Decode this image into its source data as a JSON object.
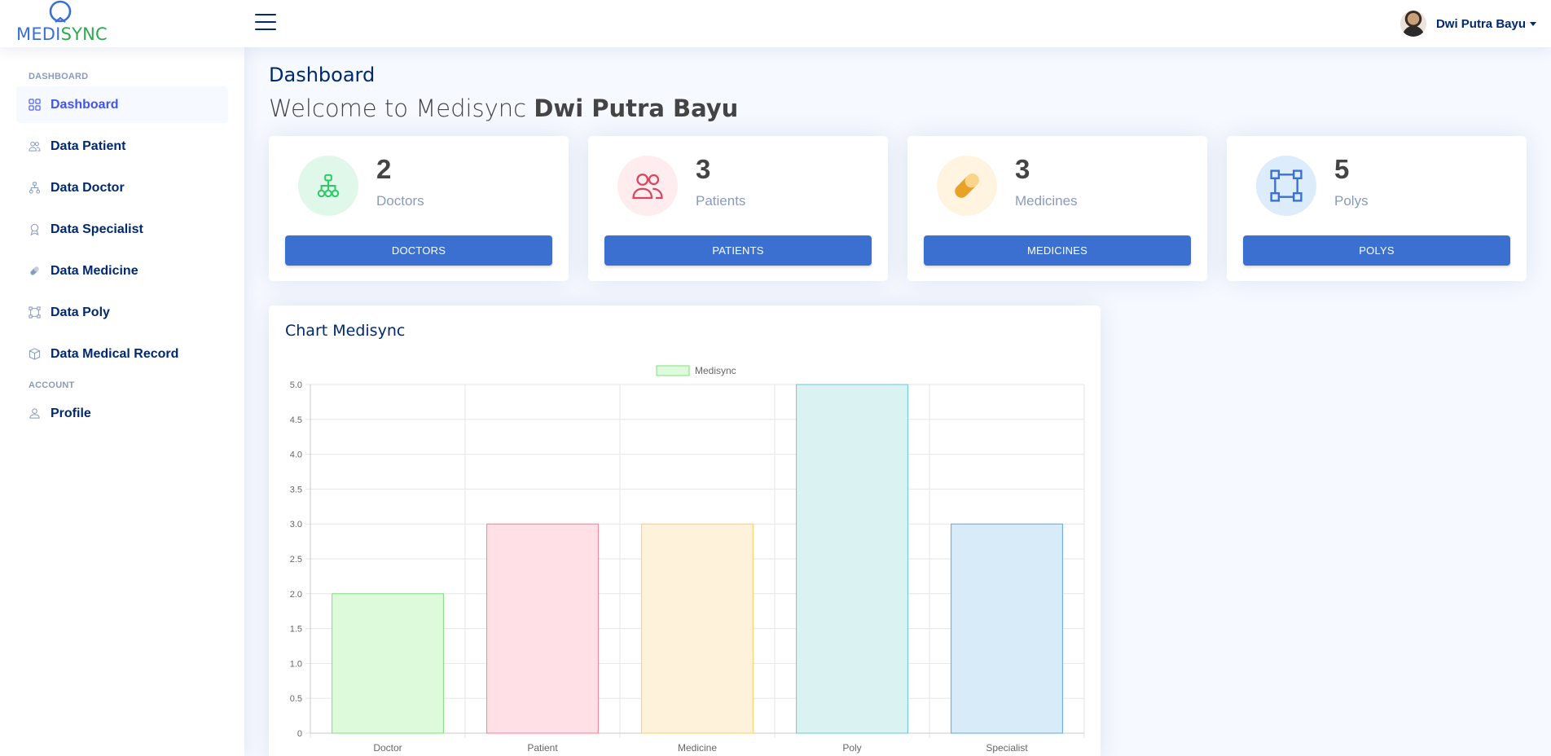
{
  "brand": {
    "part1": "MEDI",
    "part2": "SYNC"
  },
  "header": {
    "user_name": "Dwi Putra Bayu"
  },
  "sidebar": {
    "heading_dashboard": "DASHBOARD",
    "heading_account": "ACCOUNT",
    "items": [
      {
        "label": "Dashboard",
        "icon": "grid-icon"
      },
      {
        "label": "Data Patient",
        "icon": "people-icon"
      },
      {
        "label": "Data Doctor",
        "icon": "diagram-icon"
      },
      {
        "label": "Data Specialist",
        "icon": "award-icon"
      },
      {
        "label": "Data Medicine",
        "icon": "capsule-icon"
      },
      {
        "label": "Data Poly",
        "icon": "bounding-box-icon"
      },
      {
        "label": "Data Medical Record",
        "icon": "box-icon"
      }
    ],
    "profile": {
      "label": "Profile",
      "icon": "person-icon"
    }
  },
  "main": {
    "title": "Dashboard",
    "welcome_prefix": "Welcome to Medisync",
    "welcome_name": "Dwi Putra Bayu"
  },
  "stats": [
    {
      "value": "2",
      "label": "Doctors",
      "button": "DOCTORS",
      "icon": "diagram-icon",
      "bg": "#e0f8e9",
      "color": "#2eca6a"
    },
    {
      "value": "3",
      "label": "Patients",
      "button": "PATIENTS",
      "icon": "people-icon",
      "bg": "#ffecef",
      "color": "#d9455f"
    },
    {
      "value": "3",
      "label": "Medicines",
      "button": "MEDICINES",
      "icon": "capsule-icon",
      "bg": "#fff4e0",
      "color": "#e9a227"
    },
    {
      "value": "5",
      "label": "Polys",
      "button": "POLYS",
      "icon": "bounding-box-icon",
      "bg": "#dcecfa",
      "color": "#3b6fd0"
    }
  ],
  "chart_data": {
    "type": "bar",
    "title": "Chart Medisync",
    "categories": [
      "Doctor",
      "Patient",
      "Medicine",
      "Poly",
      "Specialist"
    ],
    "series": [
      {
        "name": "Medisync",
        "values": [
          2,
          3,
          3,
          5,
          3
        ]
      }
    ],
    "ylim": [
      0,
      5
    ],
    "yticks": [
      "0",
      "0.5",
      "1.0",
      "1.5",
      "2.0",
      "2.5",
      "3.0",
      "3.5",
      "4.0",
      "4.5",
      "5.0"
    ],
    "grid": true,
    "legend": "top-center",
    "bar_fills": [
      "#ddfadb",
      "#ffe0e6",
      "#fff2db",
      "#dbf2f2",
      "#d7ebf9"
    ],
    "bar_strokes": [
      "#7ee07a",
      "#ff7a95",
      "#ffcc66",
      "#66cccc",
      "#5fa8e0"
    ],
    "legend_fill": "#ddfadb",
    "legend_stroke": "#7ee07a"
  }
}
